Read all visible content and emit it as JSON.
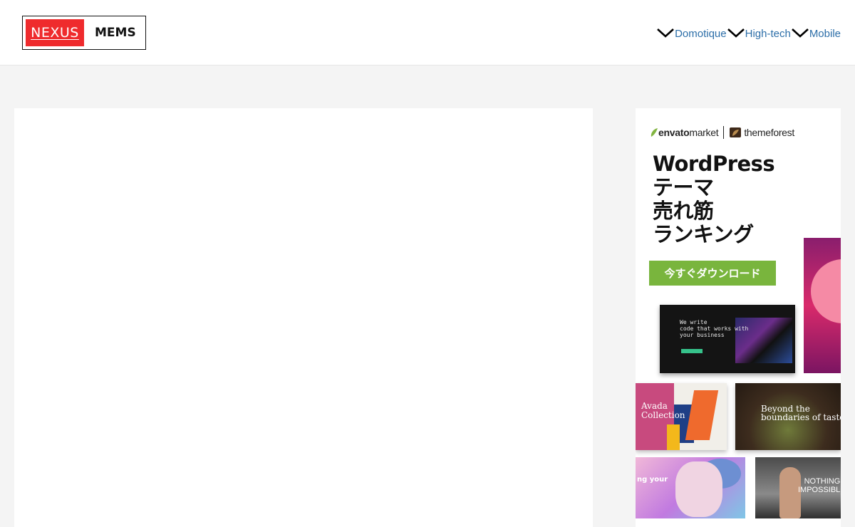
{
  "header": {
    "logo": {
      "red_text": "NEXUS",
      "dark_text": "MEMS"
    },
    "nav": [
      {
        "label": "Domotique",
        "icon": "chevron-down-icon"
      },
      {
        "label": "High-tech",
        "icon": "chevron-down-icon"
      },
      {
        "label": "Mobile",
        "icon": "chevron-down-icon"
      }
    ]
  },
  "ad": {
    "brand": {
      "envato": "envato",
      "market": "market",
      "themeforest": "themeforest"
    },
    "title_lines": [
      "WordPress",
      "テーマ",
      "売れ筋",
      "ランキング"
    ],
    "cta": "今すぐダウンロード",
    "thumbs": {
      "code": "We write\ncode that works with\nyour business",
      "avada": "Avada\nCollection",
      "food": "Beyond the\nboundaries of taste",
      "beauty": "ng your",
      "sport": "NOTHING\nIMPOSSIBL"
    }
  },
  "colors": {
    "logo_red": "#ef2b2d",
    "nav_link": "#2c6ea8",
    "cta_green": "#79b53d",
    "page_bg": "#f4f4f4"
  }
}
